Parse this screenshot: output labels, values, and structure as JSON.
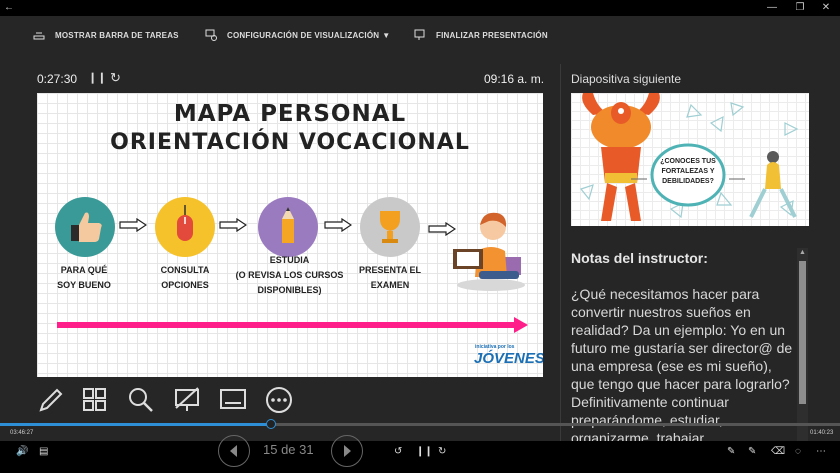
{
  "toolbar": {
    "taskbar": "MOSTRAR BARRA DE TAREAS",
    "display_settings": "CONFIGURACIÓN DE VISUALIZACIÓN",
    "display_settings_arrow": "▼",
    "end_show": "FINALIZAR PRESENTACIÓN"
  },
  "presenter": {
    "timer": "0:27:30",
    "clock": "09:16 a. m.",
    "next_slide_label": "Diapositiva siguiente"
  },
  "slide": {
    "title_line1": "MAPA PERSONAL",
    "title_line2": "ORIENTACIÓN VOCACIONAL",
    "steps": [
      {
        "line1": "PARA QUÉ",
        "line2": "SOY BUENO"
      },
      {
        "line1": "CONSULTA",
        "line2": "OPCIONES"
      },
      {
        "line1": "ESTUDIA",
        "line2": "(O REVISA LOS CURSOS",
        "line3": "DISPONIBLES)"
      },
      {
        "line1": "PRESENTA EL",
        "line2": "EXAMEN"
      }
    ],
    "logo_small": "iniciativa por los",
    "logo_big": "JÓVENES",
    "colors": {
      "teal": "#3a9a98",
      "yellow": "#f6c22c",
      "purple": "#9b7bbf",
      "gray": "#c9c9c9",
      "pink": "#ff1e8a"
    }
  },
  "preview": {
    "bubble_text_1": "¿CONOCES TUS",
    "bubble_text_2": "FORTALEZAS Y",
    "bubble_text_3": "DEBILIDADES?"
  },
  "notes": {
    "title": "Notas del instructor:",
    "text": "¿Qué necesitamos hacer para convertir nuestros sueños en realidad? Da un ejemplo: Yo en un futuro me gustaría ser director@ de una empresa (ese es mi sueño), que tengo que hacer para lograrlo? Definitivamente continuar preparándome, estudiar, organizarme, trabajar"
  },
  "playback": {
    "elapsed": "03:46:27",
    "remaining": "01:40:23",
    "slide_counter": "15 de 31"
  }
}
